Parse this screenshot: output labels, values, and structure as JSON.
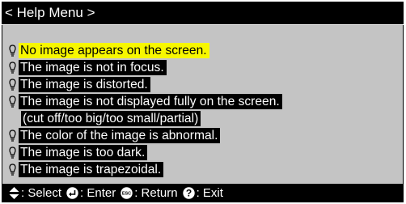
{
  "title": "< Help Menu >",
  "items": [
    {
      "text": "No image appears on the screen.",
      "selected": true,
      "bulb": true
    },
    {
      "text": "The image is not in focus.",
      "selected": false,
      "bulb": true
    },
    {
      "text": "The image is distorted.",
      "selected": false,
      "bulb": true
    },
    {
      "text": "The image is not displayed fully on the screen.",
      "selected": false,
      "bulb": true
    },
    {
      "text": "(cut off/too big/too small/partial)",
      "selected": false,
      "bulb": false
    },
    {
      "text": "The color of the image is abnormal.",
      "selected": false,
      "bulb": true
    },
    {
      "text": "The image is too dark.",
      "selected": false,
      "bulb": true
    },
    {
      "text": "The image is trapezoidal.",
      "selected": false,
      "bulb": true
    }
  ],
  "footer": {
    "select_label": ": Select",
    "enter_label": ": Enter",
    "return_label": ": Return",
    "exit_label": ": Exit",
    "esc_text": "ESC",
    "help_text": "?"
  },
  "colors": {
    "highlight": "#f7f700",
    "panel": "#c4c4c4",
    "bar": "#000000"
  },
  "icons": [
    "lightbulb-icon",
    "up-down-arrows-icon",
    "enter-icon",
    "esc-icon",
    "help-icon"
  ]
}
